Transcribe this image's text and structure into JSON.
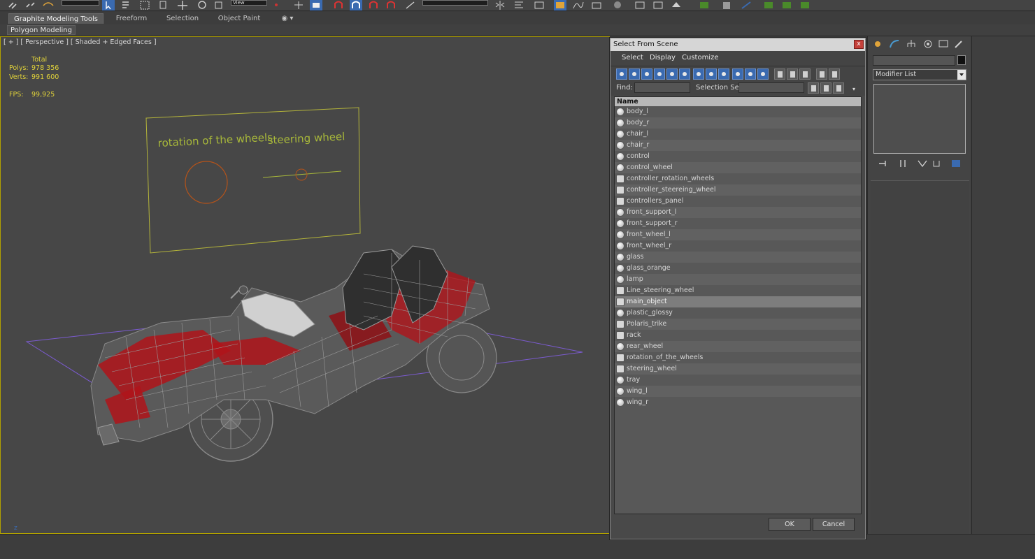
{
  "ribbon": {
    "tabs": [
      {
        "label": "Graphite Modeling Tools",
        "active": true
      },
      {
        "label": "Freeform",
        "active": false
      },
      {
        "label": "Selection",
        "active": false
      },
      {
        "label": "Object Paint",
        "active": false
      }
    ],
    "sub_label": "Polygon Modeling",
    "toolbar_dropdown_value": "View"
  },
  "viewport": {
    "label": "[ + ] [ Perspective ] [ Shaded + Edged Faces ]",
    "stats": {
      "header": "Total",
      "polys_label": "Polys:",
      "polys_value": "978 356",
      "verts_label": "Verts:",
      "verts_value": "991 600",
      "fps_label": "FPS:",
      "fps_value": "99,925"
    },
    "panel_text_left": "rotation of the wheels",
    "panel_text_right": "steering wheel",
    "axis_label": "z"
  },
  "dialog": {
    "title": "Select From Scene",
    "close_glyph": "x",
    "menu": [
      "Select",
      "Display",
      "Customize"
    ],
    "find_label": "Find:",
    "find_value": "",
    "selection_set_label": "Selection Set:",
    "selection_set_value": "",
    "column_header": "Name",
    "items": [
      {
        "name": "body_l",
        "icon": "sphere-icon"
      },
      {
        "name": "body_r",
        "icon": "sphere-icon"
      },
      {
        "name": "chair_l",
        "icon": "sphere-icon"
      },
      {
        "name": "chair_r",
        "icon": "sphere-icon"
      },
      {
        "name": "control",
        "icon": "sphere-icon"
      },
      {
        "name": "control_wheel",
        "icon": "sphere-icon"
      },
      {
        "name": "controller_rotation_wheels",
        "icon": "shape-icon"
      },
      {
        "name": "controller_steereing_wheel",
        "icon": "shape-icon"
      },
      {
        "name": "controllers_panel",
        "icon": "shape-icon"
      },
      {
        "name": "front_support_l",
        "icon": "sphere-icon"
      },
      {
        "name": "front_support_r",
        "icon": "sphere-icon"
      },
      {
        "name": "front_wheel_l",
        "icon": "sphere-icon"
      },
      {
        "name": "front_wheel_r",
        "icon": "sphere-icon"
      },
      {
        "name": "glass",
        "icon": "sphere-icon"
      },
      {
        "name": "glass_orange",
        "icon": "sphere-icon"
      },
      {
        "name": "lamp",
        "icon": "sphere-icon"
      },
      {
        "name": "Line_steering_wheel",
        "icon": "shape-icon"
      },
      {
        "name": "main_object",
        "icon": "shape-icon",
        "selected": true
      },
      {
        "name": "plastic_glossy",
        "icon": "sphere-icon"
      },
      {
        "name": "Polaris_trike",
        "icon": "shape-icon"
      },
      {
        "name": "rack",
        "icon": "shape-icon"
      },
      {
        "name": "rear_wheel",
        "icon": "sphere-icon"
      },
      {
        "name": "rotation_of_the_wheels",
        "icon": "shape-icon"
      },
      {
        "name": "steering_wheel",
        "icon": "shape-icon"
      },
      {
        "name": "tray",
        "icon": "sphere-icon"
      },
      {
        "name": "wing_l",
        "icon": "sphere-icon"
      },
      {
        "name": "wing_r",
        "icon": "sphere-icon"
      }
    ],
    "ok_label": "OK",
    "cancel_label": "Cancel"
  },
  "command_panel": {
    "name_value": "",
    "modifier_list_label": "Modifier List"
  },
  "colors": {
    "viewport_border": "#b2a200",
    "stat_text": "#e0d23a",
    "wire": "#8a8a8a",
    "body_red": "#b0141a",
    "ground_plane": "#7b5bd0",
    "panel_border": "#b4b43a",
    "panel_text": "#a8b83a",
    "circle_orange": "#b4531a"
  }
}
